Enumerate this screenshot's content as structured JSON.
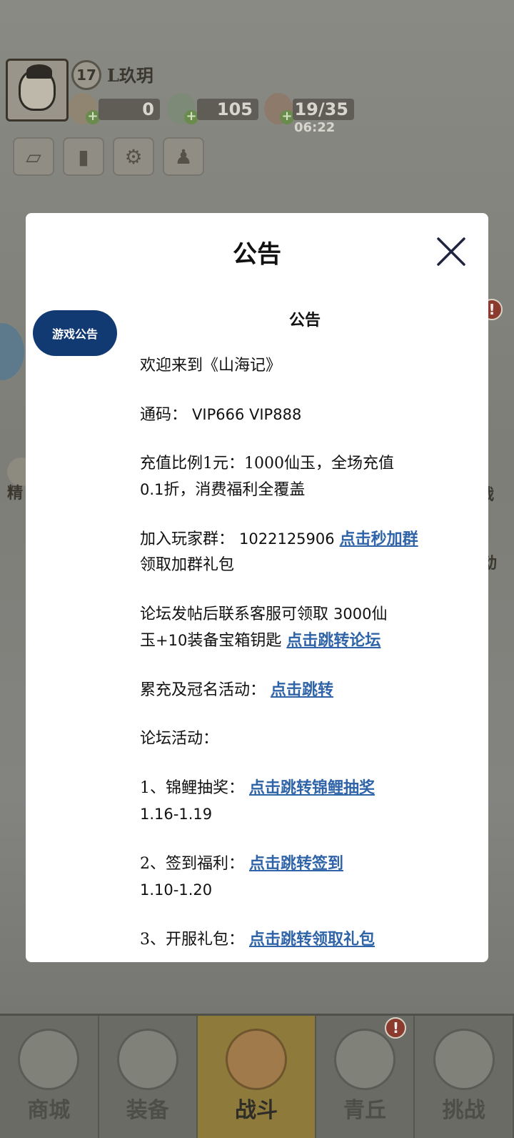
{
  "player": {
    "level": "17",
    "name": "L玖玥",
    "gold": "0",
    "jade": "105",
    "stamina": "19/35",
    "timer": "06:22"
  },
  "hud": {
    "plus": "+",
    "alert": "!"
  },
  "side_labels": {
    "left_label": "精",
    "right_label_1": "战",
    "right_label_2": "动"
  },
  "bottom_nav": [
    {
      "label": "商城"
    },
    {
      "label": "装备"
    },
    {
      "label": "战斗"
    },
    {
      "label": "青丘"
    },
    {
      "label": "挑战"
    }
  ],
  "modal": {
    "title": "公告",
    "tab_label": "游戏公告",
    "heading": "公告",
    "welcome": "欢迎来到《山海记》",
    "code_label": "通码：",
    "code_value": "VIP666 VIP888",
    "recharge_label": "充值比例1元：",
    "recharge_value": "1000仙玉，全场充值",
    "recharge_line2_num": "0.1",
    "recharge_line2": "折，消费福利全覆盖",
    "group_label": "加入玩家群：",
    "group_number": "1022125906",
    "group_link": "点击秒加群",
    "group_line2": "领取加群礼包",
    "forum_line1": "论坛发帖后联系客服可领取",
    "forum_amount": "3000",
    "forum_line1_end": "仙",
    "forum_line2_start": "玉",
    "forum_line2_num": "+10",
    "forum_line2": "装备宝箱钥匙",
    "forum_link": "点击跳转论坛",
    "cumulative_label": "累充及冠名活动：",
    "cumulative_link": "点击跳转",
    "forum_activities": "论坛活动：",
    "activities": [
      {
        "label": "1、锦鲤抽奖：",
        "link": "点击跳转锦鲤抽奖",
        "dates": "1.16-1.19"
      },
      {
        "label": "2、签到福利：",
        "link": "点击跳转签到",
        "dates": "1.10-1.20"
      },
      {
        "label": "3、开服礼包：",
        "link": "点击跳转领取礼包",
        "dates": ""
      }
    ]
  },
  "colors": {
    "tab_bg": "#123a72",
    "link": "#2f64a8",
    "overlay": "#7d7d76"
  }
}
